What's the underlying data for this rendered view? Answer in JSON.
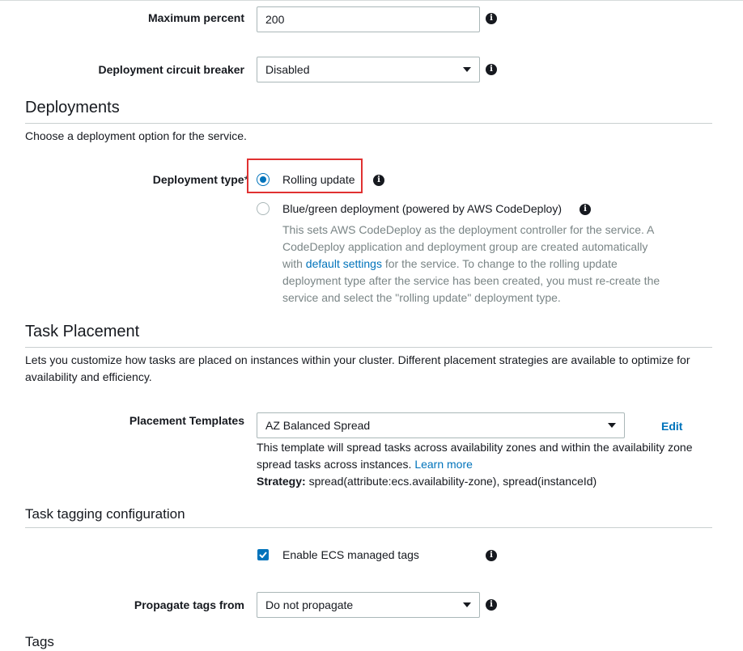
{
  "max_percent": {
    "label": "Maximum percent",
    "value": "200"
  },
  "circuit_breaker": {
    "label": "Deployment circuit breaker",
    "value": "Disabled"
  },
  "deployments": {
    "title": "Deployments",
    "description": "Choose a deployment option for the service.",
    "type_label": "Deployment type",
    "required_mark": "*",
    "options": [
      {
        "label": "Rolling update",
        "selected": true
      },
      {
        "label": "Blue/green deployment (powered by AWS CodeDeploy)",
        "selected": false
      }
    ],
    "bluegreen_desc_1": "This sets AWS CodeDeploy as the deployment controller for the service. A CodeDeploy application and deployment group are created automatically with ",
    "bluegreen_link": "default settings",
    "bluegreen_desc_2": " for the service. To change to the rolling update deployment type after the service has been created, you must re-create the service and select the \"rolling update\" deployment type."
  },
  "task_placement": {
    "title": "Task Placement",
    "description": "Lets you customize how tasks are placed on instances within your cluster. Different placement strategies are available to optimize for availability and efficiency.",
    "templates_label": "Placement Templates",
    "templates_value": "AZ Balanced Spread",
    "edit_label": "Edit",
    "help_text": "This template will spread tasks across availability zones and within the availability zone spread tasks across instances. ",
    "learn_more": "Learn more",
    "strategy_label": "Strategy:",
    "strategy_value": " spread(attribute:ecs.availability-zone), spread(instanceId)"
  },
  "tagging": {
    "title": "Task tagging configuration",
    "managed_tags_label": "Enable ECS managed tags",
    "managed_tags_checked": true,
    "propagate_label": "Propagate tags from",
    "propagate_value": "Do not propagate"
  },
  "tags": {
    "title": "Tags"
  },
  "colors": {
    "accent": "#0073bb",
    "highlight": "#e03131",
    "muted_text": "#7a8586"
  },
  "icons": {
    "info": "info-icon",
    "caret": "caret-down-icon",
    "check": "checkmark-icon"
  }
}
